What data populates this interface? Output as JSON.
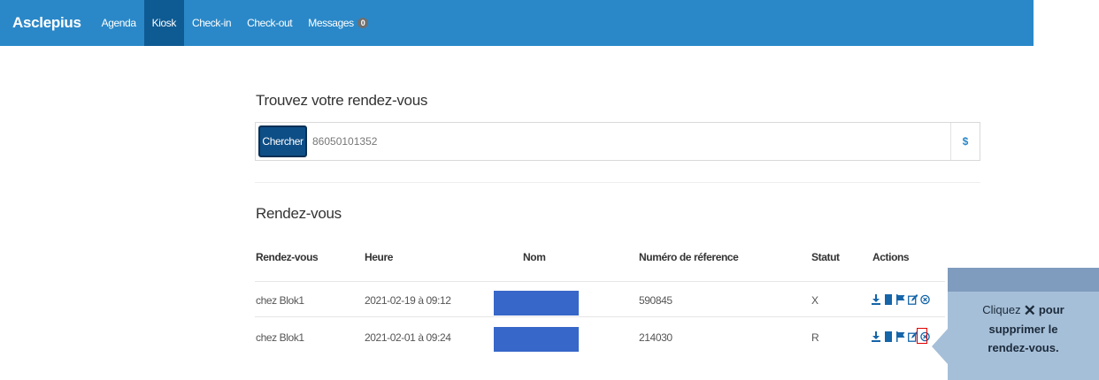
{
  "navbar": {
    "brand": "Asclepius",
    "items": [
      {
        "label": "Agenda"
      },
      {
        "label": "Kiosk",
        "active": true
      },
      {
        "label": "Check-in"
      },
      {
        "label": "Check-out"
      },
      {
        "label": "Messages",
        "badge": "0"
      }
    ]
  },
  "search": {
    "title": "Trouvez votre rendez-vous",
    "button_label": "Chercher",
    "value": "86050101352",
    "suffix": "$"
  },
  "appointments": {
    "title": "Rendez-vous",
    "columns": [
      "Rendez-vous",
      "Heure",
      "Nom",
      "Numéro de réference",
      "Statut",
      "Actions"
    ],
    "rows": [
      {
        "place": "chez Blok1",
        "time": "2021-02-19 à 09:12",
        "reference": "590845",
        "status": "X"
      },
      {
        "place": "chez Blok1",
        "time": "2021-02-01 à 09:24",
        "reference": "214030",
        "status": "R"
      }
    ],
    "action_icons": [
      "download-icon",
      "document-icon",
      "flag-icon",
      "edit-icon",
      "delete-icon"
    ]
  },
  "callout": {
    "line1_prefix": "Cliquez",
    "symbol": "✕",
    "line1_suffix": "pour",
    "line2": "supprimer le",
    "line3": "rendez-vous."
  },
  "colors": {
    "navbar": "#2a88c8",
    "navbar_active": "#0e5a93",
    "button": "#0e4e86",
    "redacted": "#3767c8",
    "icon": "#1565a8",
    "highlight": "#e00000",
    "callout": "#a6bfd8"
  }
}
